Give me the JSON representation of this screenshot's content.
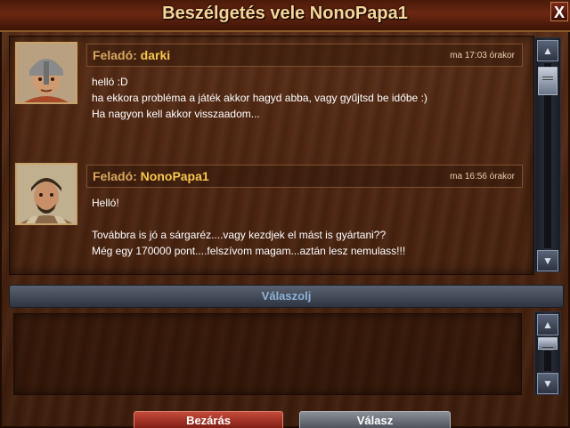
{
  "window": {
    "title": "Beszélgetés vele NonoPapa1",
    "close_label": "X"
  },
  "messages": [
    {
      "from_label": "Feladó:",
      "sender": "darki",
      "time": "ma 17:03 órakor",
      "lines": [
        "helló :D",
        "ha ekkora probléma a játék akkor hagyd abba, vagy gyűjtsd be időbe :)",
        "Ha nagyon kell akkor visszaadom..."
      ],
      "avatar": "soldier-helmet-avatar"
    },
    {
      "from_label": "Feladó:",
      "sender": "NonoPapa1",
      "time": "ma 16:56 órakor",
      "lines": [
        "Helló!",
        "",
        "Továbbra is jó a sárgaréz....vagy kezdjek el mást is gyártani??",
        "Még egy 170000 pont....felszívom magam...aztán lesz nemulass!!!"
      ],
      "avatar": "bearded-nobleman-avatar"
    }
  ],
  "reply": {
    "header": "Válaszolj",
    "value": ""
  },
  "buttons": {
    "close": "Bezárás",
    "reply": "Válasz"
  },
  "colors": {
    "accent_gold": "#f6c850",
    "reply_header": "#8fb4d8",
    "close_button": "#c44a3a"
  }
}
